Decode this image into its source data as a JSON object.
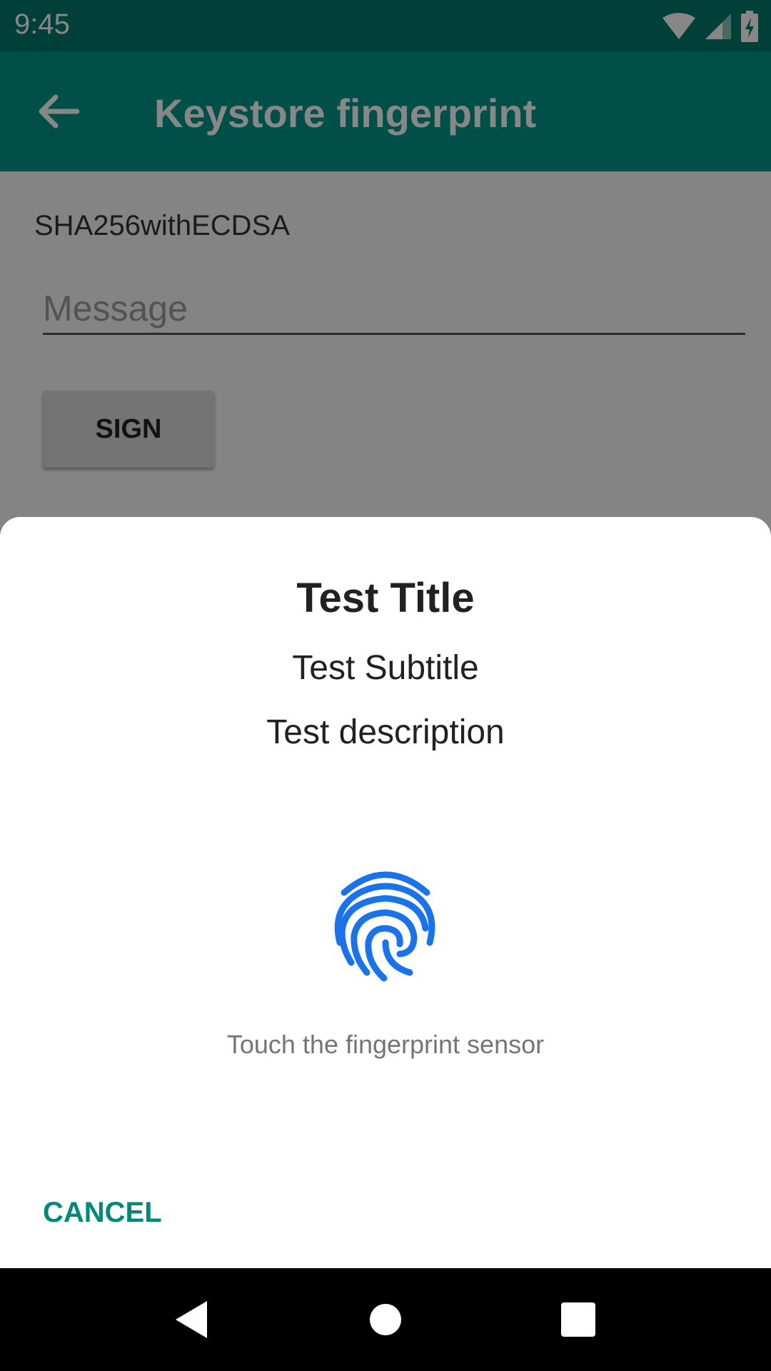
{
  "status_bar": {
    "time": "9:45"
  },
  "app_bar": {
    "title": "Keystore fingerprint"
  },
  "main": {
    "algorithm": "SHA256withECDSA",
    "message_placeholder": "Message",
    "message_value": "",
    "sign_label": "SIGN"
  },
  "dialog": {
    "title": "Test Title",
    "subtitle": "Test Subtitle",
    "description": "Test description",
    "hint": "Touch the fingerprint sensor",
    "cancel_label": "CANCEL"
  },
  "icons": {
    "back": "arrow-back-icon",
    "fingerprint": "fingerprint-icon",
    "wifi": "wifi-icon",
    "signal": "signal-icon",
    "battery": "battery-charging-icon"
  },
  "colors": {
    "primary": "#009688",
    "primary_dark": "#00796b",
    "accent": "#00897b",
    "fingerprint": "#1a73e8"
  }
}
